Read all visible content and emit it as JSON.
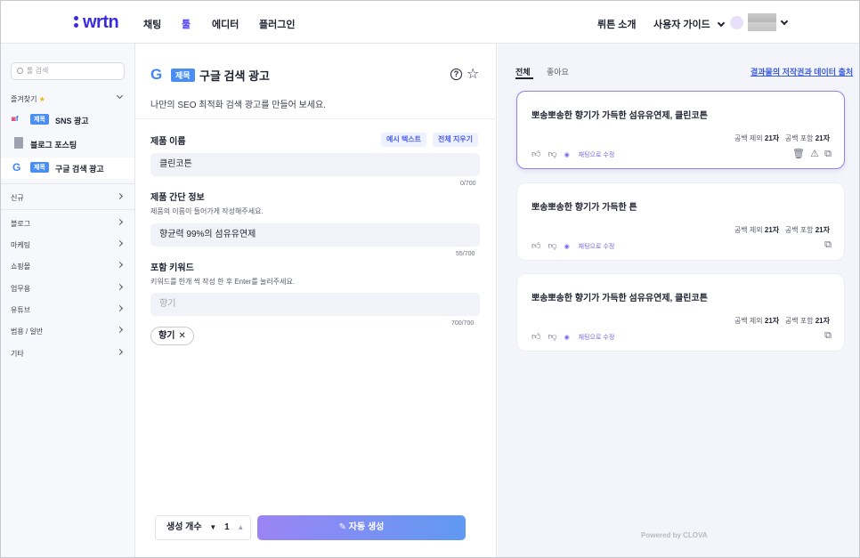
{
  "nav": {
    "logo": "wrtn",
    "items": [
      "채팅",
      "툴",
      "에디터",
      "플러그인"
    ],
    "right": [
      "뤼튼 소개",
      "사용자 가이드"
    ]
  },
  "sidebar": {
    "search_placeholder": "툴 검색",
    "favorites_label": "즐겨찾기",
    "favorites": [
      {
        "tag": "제목",
        "label": "SNS 광고"
      },
      {
        "tag": "",
        "label": "블로그 포스팅"
      },
      {
        "tag": "제목",
        "label": "구글 검색 광고"
      }
    ],
    "categories": [
      "신규",
      "블로그",
      "마케팅",
      "쇼핑몰",
      "업무용",
      "유튜브",
      "범용 / 일반",
      "기타"
    ]
  },
  "tool": {
    "tag": "제목",
    "title": "구글 검색 광고",
    "description": "나만의 SEO 최적화 검색 광고를 만들어 보세요.",
    "example_button": "예시 텍스트",
    "clear_button": "전체 지우기",
    "fields": [
      {
        "label": "제품 이름",
        "hint": "",
        "value": "클린코튼",
        "placeholder": "",
        "counter": "0/700"
      },
      {
        "label": "제품 간단 정보",
        "hint": "제품의 이름이 들어가게 작성해주세요.",
        "value": "향균력 99%의 섬유유연제",
        "placeholder": "",
        "counter": "55/700"
      },
      {
        "label": "포함 키워드",
        "hint": "키워드를 한개 씩 작성 한 후 Enter를 눌러주세요.",
        "value": "",
        "placeholder": "향기",
        "counter": "700/700"
      }
    ],
    "keyword_chip": "향기",
    "count_label": "생성 개수",
    "count_value": "1",
    "generate_button": "자동 생성"
  },
  "results": {
    "tabs": [
      "전체",
      "좋아요"
    ],
    "active_tab": "전체",
    "copyright_link": "결과물의 저작권과 데이터 출처",
    "edit_label": "채팅으로 수정",
    "cards": [
      {
        "text": "뽀송뽀송한 향기가 가득한 섬유유연제, 클린코튼",
        "stat1_label": "공백 제외",
        "stat1": "21자",
        "stat2_label": "공백 포함",
        "stat2": "21자",
        "selected": true
      },
      {
        "text": "뽀송뽀송한 향기가 가득한 튼",
        "stat1_label": "공백 제외",
        "stat1": "21자",
        "stat2_label": "공백 포함",
        "stat2": "21자",
        "selected": false
      },
      {
        "text": "뽀송뽀송한 향기가 가득한 섬유유연제, 클린코튼",
        "stat1_label": "공백 제외",
        "stat1": "21자",
        "stat2_label": "공백 포함",
        "stat2": "21자",
        "selected": false
      }
    ],
    "powered_by": "Powered by CLOVA"
  },
  "colors": {
    "brand": "#3a2be0",
    "accent": "#4a3bf0",
    "tag": "#4b8ef2",
    "selected_border": "#8f84e8"
  }
}
